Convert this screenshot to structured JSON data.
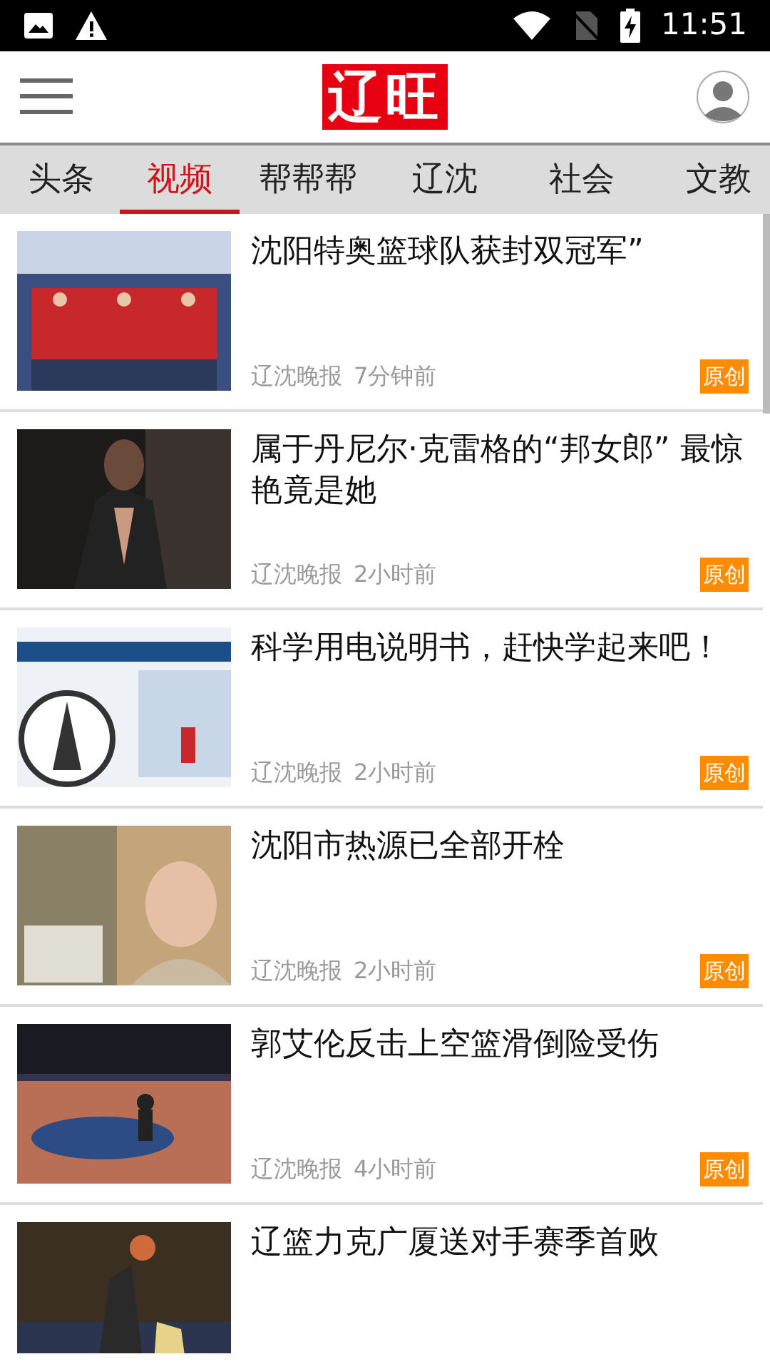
{
  "status_bar": {
    "time": "11:51"
  },
  "header": {
    "logo": "辽旺"
  },
  "tabs": [
    {
      "label": "头条",
      "selected": false
    },
    {
      "label": "视频",
      "selected": true
    },
    {
      "label": "帮帮帮",
      "selected": false
    },
    {
      "label": "辽沈",
      "selected": false
    },
    {
      "label": "社会",
      "selected": false
    },
    {
      "label": "文教",
      "selected": false
    }
  ],
  "articles": [
    {
      "title": "沈阳特奥篮球队获封双冠军”",
      "source": "辽沈晚报",
      "time": "7分钟前",
      "badge": "原创"
    },
    {
      "title": "属于丹尼尔·克雷格的“邦女郎” 最惊艳竟是她",
      "source": "辽沈晚报",
      "time": "2小时前",
      "badge": "原创"
    },
    {
      "title": "科学用电说明书，赶快学起来吧！",
      "source": "辽沈晚报",
      "time": "2小时前",
      "badge": "原创"
    },
    {
      "title": "沈阳市热源已全部开栓",
      "source": "辽沈晚报",
      "time": "2小时前",
      "badge": "原创"
    },
    {
      "title": "郭艾伦反击上空篮滑倒险受伤",
      "source": "辽沈晚报",
      "time": "4小时前",
      "badge": "原创"
    },
    {
      "title": "辽篮力克广厦送对手赛季首败"
    }
  ]
}
